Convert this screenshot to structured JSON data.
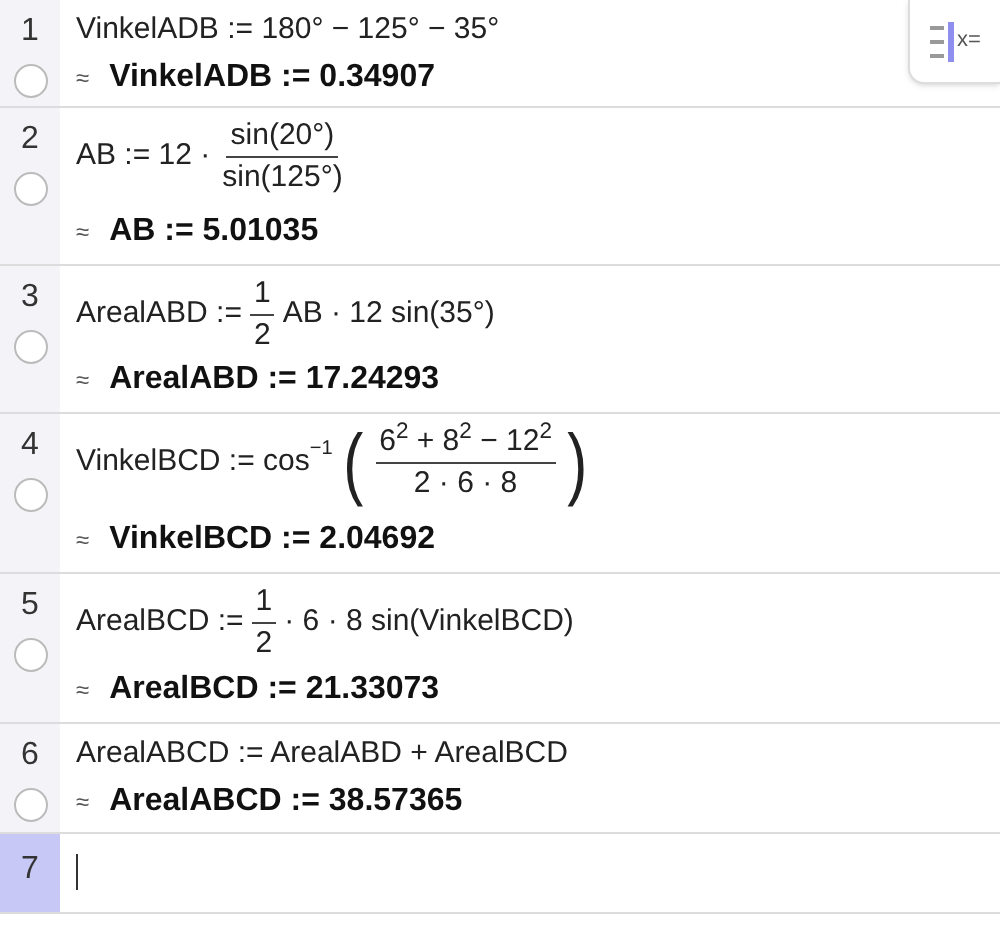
{
  "toggle_button": {
    "label": "x="
  },
  "rows": [
    {
      "number": "1",
      "selected": false,
      "input": [
        {
          "kind": "text",
          "text": "VinkelADB := 180° − 125° − 35°"
        }
      ],
      "output": {
        "marker": "≈",
        "text": "VinkelADB := 0.34907"
      }
    },
    {
      "number": "2",
      "selected": false,
      "input": [
        {
          "kind": "text",
          "text": "AB := 12 ·"
        },
        {
          "kind": "frac",
          "num": "sin(20°)",
          "den": "sin(125°)"
        }
      ],
      "output": {
        "marker": "≈",
        "text": "AB := 5.01035"
      }
    },
    {
      "number": "3",
      "selected": false,
      "input": [
        {
          "kind": "text",
          "text": "ArealABD :="
        },
        {
          "kind": "frac",
          "num": "1",
          "den": "2"
        },
        {
          "kind": "text",
          "text": "AB · 12 sin(35°)"
        }
      ],
      "output": {
        "marker": "≈",
        "text": "ArealABD := 17.24293"
      }
    },
    {
      "number": "4",
      "selected": false,
      "input": [
        {
          "kind": "text",
          "text": "VinkelBCD := cos"
        },
        {
          "kind": "sup",
          "text": "−1"
        },
        {
          "kind": "paren",
          "text": "("
        },
        {
          "kind": "frac",
          "num": "6$^{2}$ + 8$^{2}$ − 12$^{2}$",
          "den": "2 · 6 · 8"
        },
        {
          "kind": "paren",
          "text": ")"
        }
      ],
      "output": {
        "marker": "≈",
        "text": "VinkelBCD := 2.04692"
      }
    },
    {
      "number": "5",
      "selected": false,
      "input": [
        {
          "kind": "text",
          "text": "ArealBCD :="
        },
        {
          "kind": "frac",
          "num": "1",
          "den": "2"
        },
        {
          "kind": "text",
          "text": "· 6 · 8 sin(VinkelBCD)"
        }
      ],
      "output": {
        "marker": "≈",
        "text": "ArealBCD := 21.33073"
      }
    },
    {
      "number": "6",
      "selected": false,
      "input": [
        {
          "kind": "text",
          "text": "ArealABCD := ArealABD + ArealBCD"
        }
      ],
      "output": {
        "marker": "≈",
        "text": "ArealABCD := 38.57365"
      }
    },
    {
      "number": "7",
      "selected": true,
      "input": [],
      "editing": true
    }
  ]
}
